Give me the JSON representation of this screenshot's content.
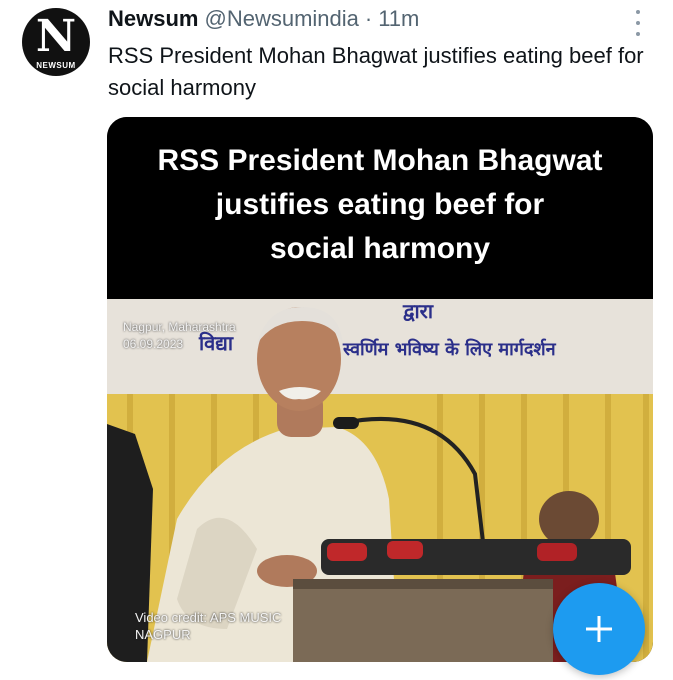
{
  "author": {
    "avatar_letter": "N",
    "avatar_word": "NEWSUM",
    "display_name": "Newsum",
    "handle": "@Newsumindia",
    "separator": "·",
    "time": "11m"
  },
  "tweet": {
    "text": "RSS President Mohan Bhagwat justifies eating beef for social harmony"
  },
  "media": {
    "headline_lines": [
      "RSS President Mohan Bhagwat",
      "justifies eating beef for",
      "social harmony"
    ],
    "location": "Nagpur, Maharashtra",
    "date": "06.09.2023",
    "banner_top": "द्वारा",
    "banner_left": "विद्या",
    "banner_right": "स्वर्णिम भविष्य के लिए मार्गदर्शन",
    "credit_line1": "Video credit: APS MUSIC",
    "credit_line2": "NAGPUR"
  },
  "icons": {
    "more": "more-vertical-icon",
    "compose": "plus-icon"
  },
  "colors": {
    "accent": "#1d9bf0",
    "text_primary": "#0f1419",
    "text_secondary": "#536471",
    "banner_yellow": "#e9c85a"
  }
}
